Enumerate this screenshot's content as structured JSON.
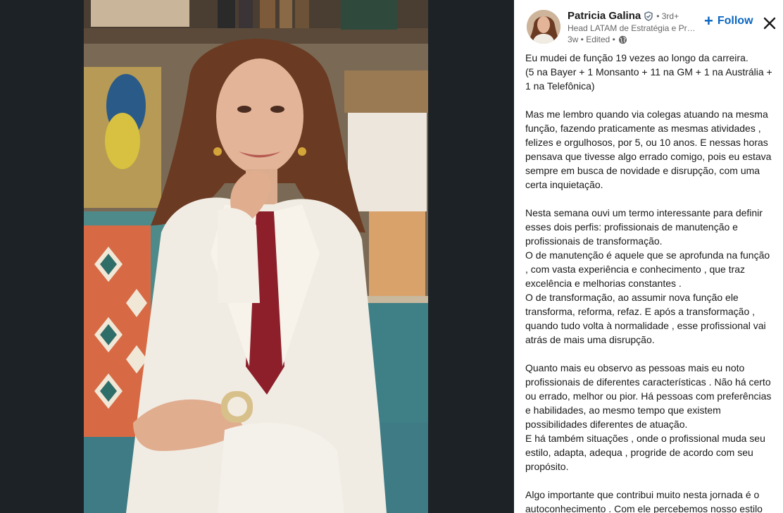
{
  "author": {
    "name": "Patricia Galina",
    "degree": "• 3rd+",
    "headline": "Head LATAM de Estratégia e Proj...",
    "meta": "3w • Edited •"
  },
  "icons": {
    "verified": "verified-shield-icon",
    "globe": "globe-icon",
    "close": "close-icon",
    "plus": "plus-icon"
  },
  "actions": {
    "follow_label": "Follow",
    "follow_plus": "+"
  },
  "colors": {
    "accent": "#0a66c2",
    "text": "#191919",
    "muted": "#666666",
    "viewer_bg": "#1d2226"
  },
  "post": {
    "paragraphs": [
      "Eu mudei de função 19 vezes ao longo da carreira.\n(5 na Bayer + 1 Monsanto + 11 na GM + 1 na Austrália + 1 na Telefônica)",
      "Mas me lembro quando via colegas atuando na mesma função, fazendo praticamente as mesmas atividades , felizes e orgulhosos, por 5, ou 10 anos. E nessas horas pensava que tivesse algo errado comigo, pois eu estava sempre em busca de novidade e disrupção, com uma certa inquietação.",
      "Nesta semana ouvi um termo interessante para definir esses dois perfis: profissionais de manutenção e profissionais de transformação.\nO de manutenção é aquele que se aprofunda na função , com vasta experiência e conhecimento , que traz excelência e melhorias constantes .\nO de transformação, ao assumir nova função ele transforma, reforma, refaz. E após a transformação , quando tudo volta à normalidade , esse profissional vai atrás de mais uma disrupção.",
      "Quanto mais eu observo as pessoas mais eu noto profissionais de diferentes características . Não há certo ou errado, melhor ou pior. Há pessoas com preferências e habilidades, ao mesmo tempo que existem possibilidades diferentes de atuação.\nE há também situações , onde o profissional muda seu estilo, adapta, adequa , progride de acordo com seu propósito.",
      "Algo importante que contribui muito nesta jornada é o autoconhecimento . Com ele percebemos nosso estilo"
    ]
  }
}
